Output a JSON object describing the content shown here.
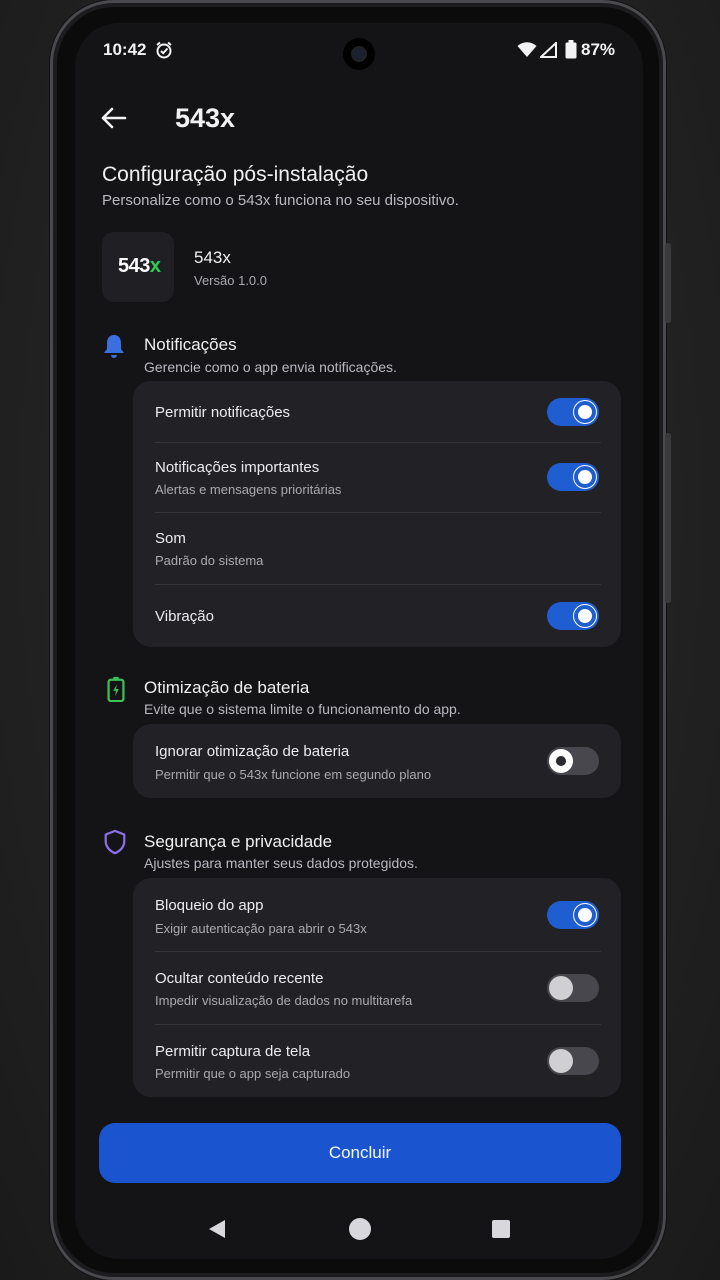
{
  "status_bar": {
    "time": "10:42",
    "battery": "87%"
  },
  "app_bar": {
    "title": "543x"
  },
  "header": {
    "title": "Configuração pós-instalação",
    "subtitle": "Personalize como o 543x funciona no seu dispositivo."
  },
  "app_info": {
    "logo_main": "543",
    "logo_accent": "x",
    "name": "543x",
    "version": "Versão 1.0.0"
  },
  "notifications": {
    "title": "Notificações",
    "subtitle": "Gerencie como o app envia notificações.",
    "rows": [
      {
        "title": "Permitir notificações",
        "subtitle": "",
        "enabled": true
      },
      {
        "title": "Notificações importantes",
        "subtitle": "Alertas e mensagens prioritárias",
        "enabled": true
      },
      {
        "title": "Som",
        "subtitle": "Padrão do sistema"
      },
      {
        "title": "Vibração",
        "subtitle": "",
        "enabled": true
      }
    ]
  },
  "battery": {
    "title": "Otimização de bateria",
    "subtitle": "Evite que o sistema limite o funcionamento do app.",
    "rows": [
      {
        "title": "Ignorar otimização de bateria",
        "subtitle": "Permitir que o 543x funcione em segundo plano",
        "enabled": false
      }
    ]
  },
  "security": {
    "title": "Segurança e privacidade",
    "subtitle": "Ajustes para manter seus dados protegidos.",
    "rows": [
      {
        "title": "Bloqueio do app",
        "subtitle": "Exigir autenticação para abrir o 543x",
        "enabled": true
      },
      {
        "title": "Ocultar conteúdo recente",
        "subtitle": "Impedir visualização de dados no multitarefa",
        "enabled": false
      },
      {
        "title": "Permitir captura de tela",
        "subtitle": "Permitir que o app seja capturado",
        "enabled": false
      }
    ]
  },
  "cta": {
    "label": "Concluir"
  },
  "colors": {
    "accent": "#1f5ed1",
    "bell": "#3b6fe0",
    "battery_icon": "#3fbf5a",
    "shield": "#8b6fe6",
    "logo_x": "#2ecc52"
  }
}
